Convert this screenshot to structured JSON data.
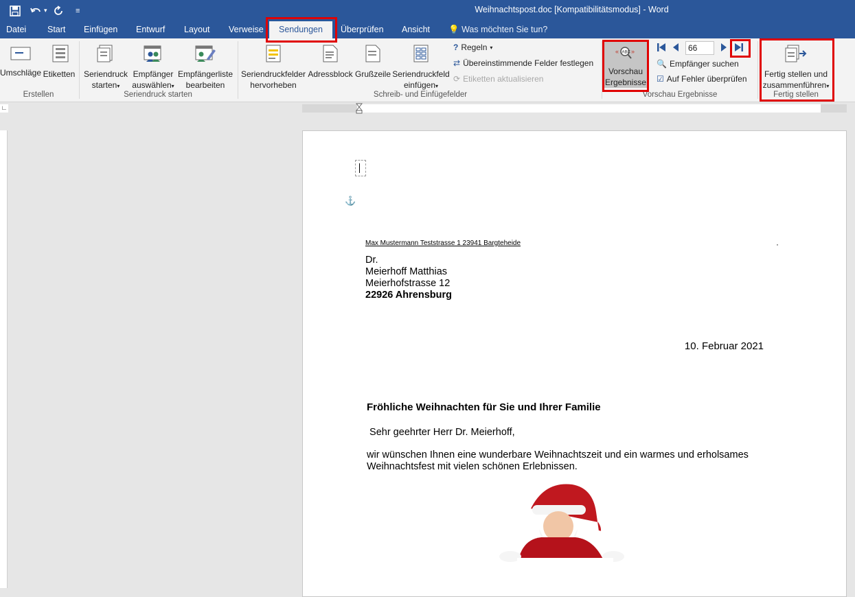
{
  "window": {
    "title": "Weihnachtspost.doc [Kompatibilitätsmodus] - Word"
  },
  "qat": {
    "save_icon": "save-icon",
    "undo_icon": "undo-icon",
    "redo_icon": "redo-icon",
    "customize_icon": "customize-qat-icon"
  },
  "tabs": [
    "Datei",
    "Start",
    "Einfügen",
    "Entwurf",
    "Layout",
    "Verweise",
    "Sendungen",
    "Überprüfen",
    "Ansicht"
  ],
  "tellme": "Was möchten Sie tun?",
  "ribbon": {
    "erstellen": {
      "label": "Erstellen",
      "umschlaege": "Umschläge",
      "etiketten": "Etiketten"
    },
    "seriendruck_starten": {
      "label": "Seriendruck starten",
      "starten_l1": "Seriendruck",
      "starten_l2": "starten",
      "empf_l1": "Empfänger",
      "empf_l2": "auswählen",
      "bearb_l1": "Empfängerliste",
      "bearb_l2": "bearbeiten"
    },
    "felder": {
      "label": "Schreib- und Einfügefelder",
      "hervor_l1": "Seriendruckfelder",
      "hervor_l2": "hervorheben",
      "adressblock": "Adressblock",
      "gruss": "Grußzeile",
      "einf_l1": "Seriendruckfeld",
      "einf_l2": "einfügen",
      "regeln": "Regeln",
      "uebereinst": "Übereinstimmende Felder festlegen",
      "etik_akt": "Etiketten aktualisieren"
    },
    "vorschau": {
      "label": "Vorschau Ergebnisse",
      "btn_l1": "Vorschau",
      "btn_l2": "Ergebnisse",
      "record": "66",
      "suchen": "Empfänger suchen",
      "fehler": "Auf Fehler überprüfen"
    },
    "fertig": {
      "label": "Fertig stellen",
      "btn_l1": "Fertig stellen und",
      "btn_l2": "zusammenführen"
    }
  },
  "document": {
    "sender": "Max Mustermann Teststrasse 1 23941 Bargteheide",
    "addr_title": "Dr.",
    "addr_name": "Meierhoff Matthias",
    "addr_street": "Meierhofstrasse 12",
    "addr_city": "22926 Ahrensburg",
    "date": "10. Februar 2021",
    "subject": "Fröhliche Weihnachten für Sie und Ihrer Familie",
    "greeting": " Sehr geehrter Herr Dr. Meierhoff,",
    "body": "wir wünschen Ihnen eine wunderbare Weihnachtszeit und ein warmes und erholsames Weihnachtsfest mit vielen schönen Erlebnissen."
  },
  "colors": {
    "accent": "#2b579a",
    "highlight": "#e00000"
  }
}
